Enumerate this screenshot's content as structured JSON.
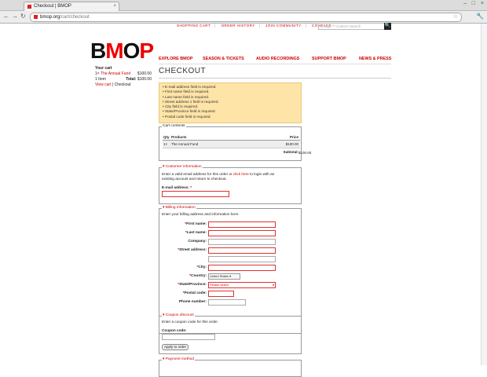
{
  "browser": {
    "tab_title": "Checkout | BMOP",
    "tab_close": "×",
    "url_host": "bmop.org",
    "url_path": "/cart/checkout",
    "back": "←",
    "forward": "→",
    "reload": "↻",
    "star": "☆",
    "wrench": "🔧",
    "min": "–",
    "max": "□",
    "close": "×"
  },
  "topnav": {
    "items": [
      "SHOPPING CART",
      "ORDER HISTORY",
      "JOIN COMMUNITY",
      "CONTACT"
    ],
    "sep": "|",
    "search_placeholder": "Google™ Custom Search",
    "search_btn": "🔍"
  },
  "logo": {
    "b": "B",
    "m": "M",
    "o": "O",
    "p": "P"
  },
  "mainnav": [
    "EXPLORE BMOP",
    "SEASON & TICKETS",
    "AUDIO RECORDINGS",
    "SUPPORT BMOP",
    "NEWS & PRESS"
  ],
  "cart": {
    "title": "Your cart",
    "item_qty": "1×",
    "item_name": "The Annual Fund",
    "item_price": "$100.00",
    "count": "1 Item",
    "total_label": "Total:",
    "total": "$100.00",
    "view_cart": "View cart",
    "sep": "|",
    "checkout": "Checkout"
  },
  "page_title": "CHECKOUT",
  "errors": [
    "E-mail address field is required.",
    "First name field is required.",
    "Last name field is required.",
    "Street address 1 field is required.",
    "City field is required.",
    "State/Province field is required.",
    "Postal code field is required."
  ],
  "cart_contents": {
    "legend": "Cart contents",
    "col_qty": "Qty",
    "col_products": "Products",
    "col_price": "Price",
    "row_qty": "1×",
    "row_product": "The Annual Fund",
    "row_price": "$100.00",
    "subtotal_label": "Subtotal:",
    "subtotal": "$100.00"
  },
  "customer": {
    "legend": "Customer information",
    "intro_a": "Enter a valid email address for this order or ",
    "intro_link": "click here",
    "intro_b": " to login with an",
    "intro_c": "existing account and return to checkout.",
    "email_label": "E-mail address:",
    "required_mark": "*"
  },
  "billing": {
    "legend": "Billing information",
    "intro": "Enter your billing address and information here.",
    "first_name": "First name:",
    "last_name": "Last name:",
    "company": "Company:",
    "street": "Street address:",
    "city": "City:",
    "country": "Country:",
    "country_value": "United States",
    "state": "State/Province:",
    "state_value": "Please select",
    "postal": "Postal code:",
    "phone": "Phone number:"
  },
  "coupon": {
    "legend": "Coupon discount",
    "intro": "Enter a coupon code for this order.",
    "label": "Coupon code:",
    "button": "Apply to order"
  },
  "payment": {
    "legend": "Payment method"
  }
}
